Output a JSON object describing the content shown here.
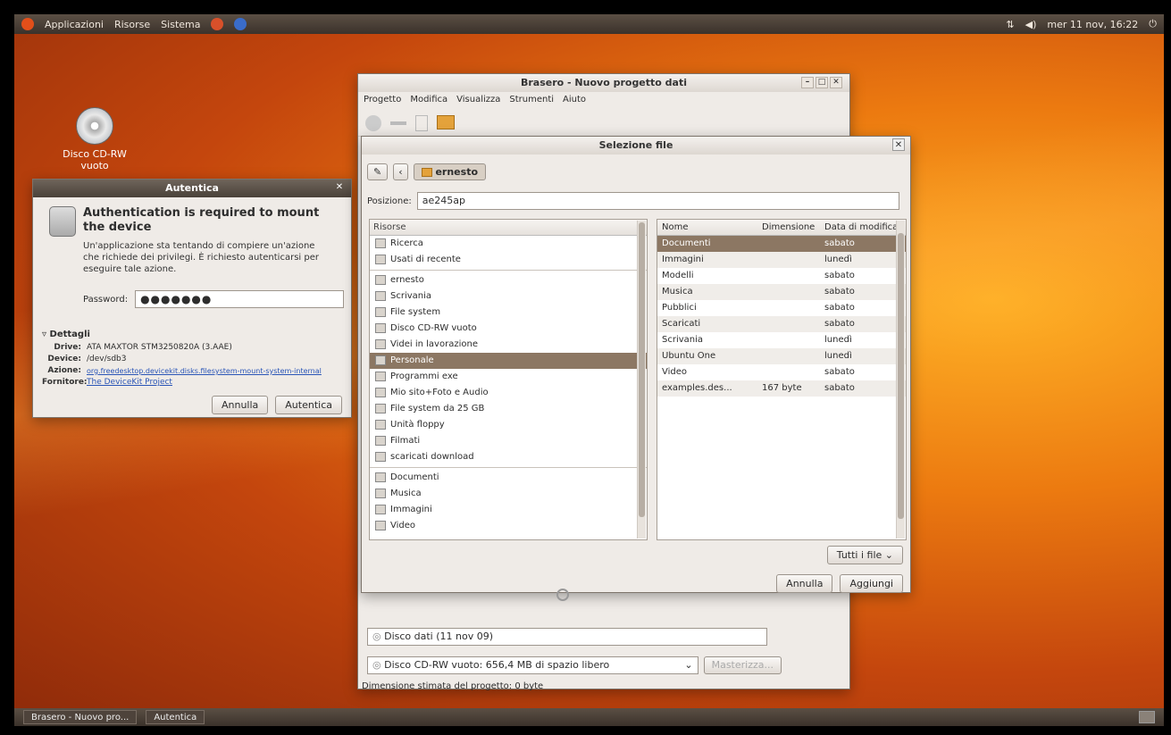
{
  "top_panel": {
    "menus": [
      "Applicazioni",
      "Risorse",
      "Sistema"
    ],
    "clock": "mer 11 nov, 16:22"
  },
  "desktop": {
    "cd_icon_label": "Disco CD-RW vuoto"
  },
  "auth_dialog": {
    "title": "Autentica",
    "heading": "Authentication is required to mount the device",
    "message": "Un'applicazione sta tentando di compiere un'azione che richiede dei privilegi. È richiesto autenticarsi per eseguire tale azione.",
    "password_label": "Password:",
    "password_value": "●●●●●●●",
    "details_label": "Dettagli",
    "details": [
      {
        "key": "Drive:",
        "value": "ATA MAXTOR STM3250820A (3.AAE)"
      },
      {
        "key": "Device:",
        "value": "/dev/sdb3"
      },
      {
        "key": "Azione:",
        "value": "org.freedesktop.devicekit.disks.filesystem-mount-system-internal"
      },
      {
        "key": "Fornitore:",
        "value": "The DeviceKit Project"
      }
    ],
    "cancel": "Annulla",
    "ok": "Autentica"
  },
  "brasero": {
    "title": "Brasero - Nuovo progetto dati",
    "menu": [
      "Progetto",
      "Modifica",
      "Visualizza",
      "Strumenti",
      "Aiuto"
    ],
    "disc_name": "Disco dati (11 nov 09)",
    "target": "Disco CD-RW vuoto: 656,4 MB di spazio libero",
    "burn": "Masterizza...",
    "status": "Dimensione stimata del progetto: 0 byte"
  },
  "file_chooser": {
    "title": "Selezione file",
    "path_button": "ernesto",
    "location_label": "Posizione:",
    "location_value": "ae245ap",
    "places_header": "Risorse",
    "places": [
      {
        "label": "Ricerca",
        "icon": "search-icon"
      },
      {
        "label": "Usati di recente",
        "icon": "recent-icon"
      },
      {
        "label": "ernesto",
        "icon": "home-icon",
        "sep_before": true
      },
      {
        "label": "Scrivania",
        "icon": "desktop-icon"
      },
      {
        "label": "File system",
        "icon": "drive-icon"
      },
      {
        "label": "Disco CD-RW vuoto",
        "icon": "cd-icon"
      },
      {
        "label": "Videi in lavorazione",
        "icon": "drive-icon"
      },
      {
        "label": "Personale",
        "icon": "drive-icon",
        "selected": true
      },
      {
        "label": "Programmi exe",
        "icon": "drive-icon"
      },
      {
        "label": "Mio sito+Foto e Audio",
        "icon": "drive-icon"
      },
      {
        "label": "File system da 25 GB",
        "icon": "drive-icon"
      },
      {
        "label": "Unità floppy",
        "icon": "floppy-icon"
      },
      {
        "label": "Filmati",
        "icon": "drive-icon"
      },
      {
        "label": "scaricati download",
        "icon": "drive-icon"
      },
      {
        "label": "Documenti",
        "icon": "folder-icon",
        "sep_before": true
      },
      {
        "label": "Musica",
        "icon": "music-folder-icon"
      },
      {
        "label": "Immagini",
        "icon": "pictures-folder-icon"
      },
      {
        "label": "Video",
        "icon": "video-folder-icon"
      }
    ],
    "columns": [
      "Nome",
      "Dimensione",
      "Data di modifica"
    ],
    "files": [
      {
        "name": "Documenti",
        "size": "",
        "date": "sabato",
        "selected": true
      },
      {
        "name": "Immagini",
        "size": "",
        "date": "lunedì"
      },
      {
        "name": "Modelli",
        "size": "",
        "date": "sabato"
      },
      {
        "name": "Musica",
        "size": "",
        "date": "sabato"
      },
      {
        "name": "Pubblici",
        "size": "",
        "date": "sabato"
      },
      {
        "name": "Scaricati",
        "size": "",
        "date": "sabato"
      },
      {
        "name": "Scrivania",
        "size": "",
        "date": "lunedì"
      },
      {
        "name": "Ubuntu One",
        "size": "",
        "date": "lunedì"
      },
      {
        "name": "Video",
        "size": "",
        "date": "sabato"
      },
      {
        "name": "examples.des...",
        "size": "167 byte",
        "date": "sabato"
      }
    ],
    "filter": "Tutti i file",
    "cancel": "Annulla",
    "add": "Aggiungi"
  },
  "taskbar": [
    "Brasero - Nuovo pro...",
    "Autentica"
  ]
}
